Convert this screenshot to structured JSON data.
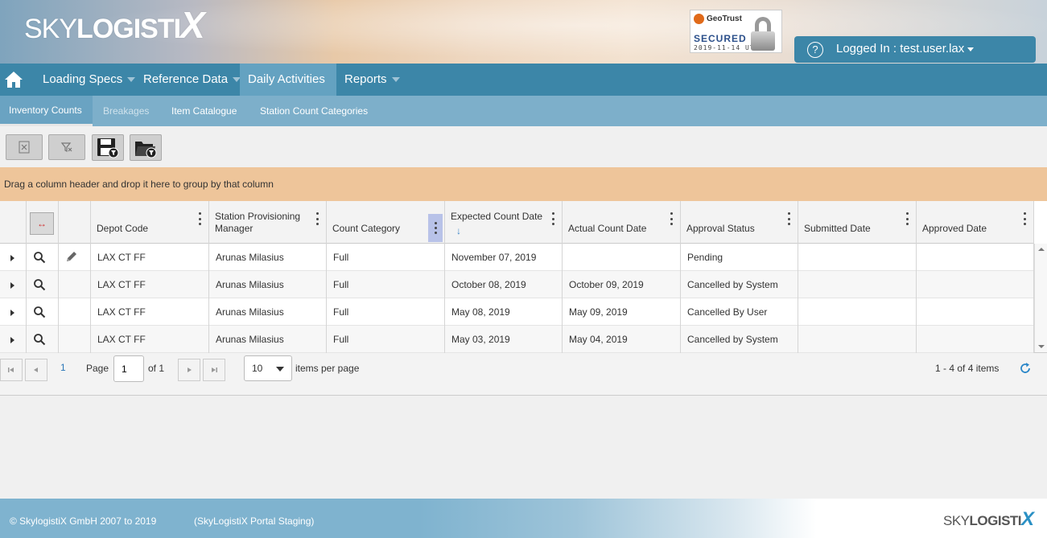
{
  "header": {
    "logo_prefix": "SKY",
    "logo_main": "LOGISTI",
    "logo_x": "X",
    "seal": {
      "brand": "GeoTrust",
      "status": "SECURED",
      "date": "2019-11-14 UTC"
    },
    "help_glyph": "?",
    "user_label": "Logged In : test.user.lax"
  },
  "mainnav": {
    "home_icon": "home-icon",
    "items": [
      {
        "label": "Loading Specs",
        "dropdown": true,
        "active": false
      },
      {
        "label": "Reference Data",
        "dropdown": true,
        "active": false
      },
      {
        "label": "Daily Activities",
        "dropdown": false,
        "active": true
      },
      {
        "label": "Reports",
        "dropdown": true,
        "active": false
      }
    ]
  },
  "subnav": {
    "items": [
      {
        "label": "Inventory Counts",
        "state": "active"
      },
      {
        "label": "Breakages",
        "state": "disabled"
      },
      {
        "label": "Item Catalogue",
        "state": "normal"
      },
      {
        "label": "Station Count Categories",
        "state": "normal"
      }
    ]
  },
  "toolbar": {
    "buttons": [
      "export-excel-icon",
      "clear-filter-icon",
      "save-filter-icon",
      "open-filter-icon"
    ]
  },
  "groupbar": {
    "text": "Drag a column header and drop it here to group by that column"
  },
  "grid": {
    "resize_glyph": "↔",
    "sort_glyph": "↓",
    "columns": [
      "Depot Code",
      "Station Provisioning Manager",
      "Count Category",
      "Expected Count Date",
      "Actual Count Date",
      "Approval Status",
      "Submitted Date",
      "Approved Date"
    ],
    "rows": [
      {
        "editable": true,
        "cells": [
          "LAX CT FF",
          "Arunas Milasius",
          "Full",
          "November 07, 2019",
          "",
          "Pending",
          "",
          ""
        ]
      },
      {
        "editable": false,
        "cells": [
          "LAX CT FF",
          "Arunas Milasius",
          "Full",
          "October 08, 2019",
          "October 09, 2019",
          "Cancelled by System",
          "",
          ""
        ]
      },
      {
        "editable": false,
        "cells": [
          "LAX CT FF",
          "Arunas Milasius",
          "Full",
          "May 08, 2019",
          "May 09, 2019",
          "Cancelled By User",
          "",
          ""
        ]
      },
      {
        "editable": false,
        "cells": [
          "LAX CT FF",
          "Arunas Milasius",
          "Full",
          "May 03, 2019",
          "May 04, 2019",
          "Cancelled by System",
          "",
          ""
        ]
      }
    ]
  },
  "pager": {
    "current_page": "1",
    "page_label": "Page",
    "page_value": "1",
    "of_label": "of 1",
    "page_size": "10",
    "per_page_label": "items per page",
    "info": "1 - 4 of 4 items"
  },
  "footer": {
    "copyright": "© SkylogistiX GmbH 2007 to 2019",
    "environment": "(SkyLogistiX Portal Staging)",
    "logo_prefix": "SKY",
    "logo_main": "LOGISTI",
    "logo_x": "X"
  }
}
